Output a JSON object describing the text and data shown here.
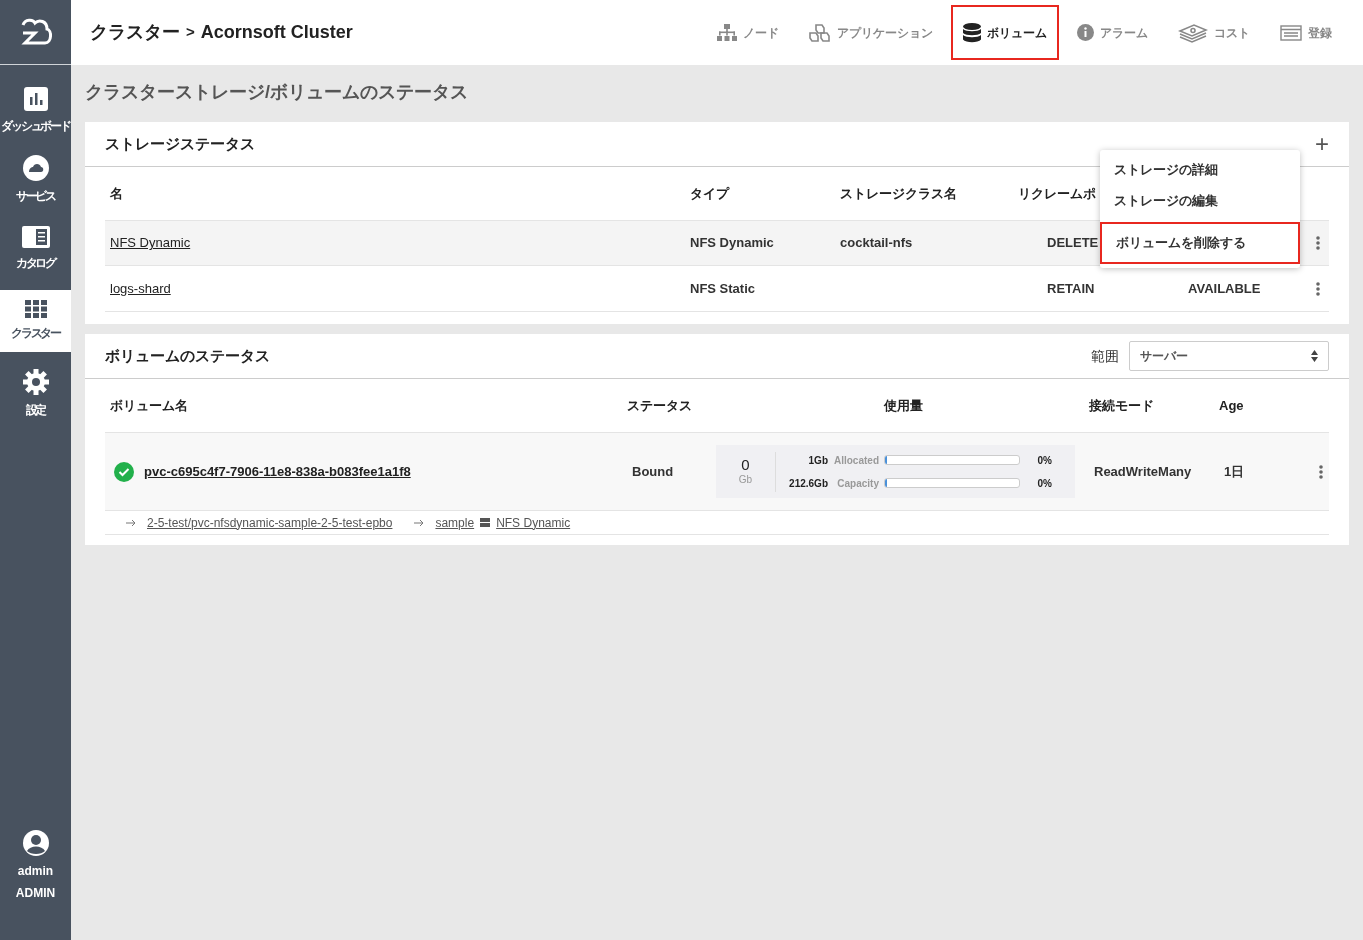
{
  "sidebar": {
    "items": [
      {
        "label": "ダッシュボード",
        "selected": false
      },
      {
        "label": "サービス",
        "selected": false
      },
      {
        "label": "カタログ",
        "selected": false
      },
      {
        "label": "クラスター",
        "selected": true
      },
      {
        "label": "設定",
        "selected": false
      }
    ],
    "user": {
      "name": "admin",
      "role": "ADMIN"
    }
  },
  "header": {
    "breadcrumb_root": "クラスター",
    "separator": ">",
    "cluster": "Acornsoft Cluster",
    "nav": [
      {
        "label": "ノード",
        "selected": false,
        "highlighted": false
      },
      {
        "label": "アプリケーション",
        "selected": false,
        "highlighted": false
      },
      {
        "label": "ボリューム",
        "selected": true,
        "highlighted": true
      },
      {
        "label": "アラーム",
        "selected": false,
        "highlighted": false
      },
      {
        "label": "コスト",
        "selected": false,
        "highlighted": false
      },
      {
        "label": "登録",
        "selected": false,
        "highlighted": false
      }
    ]
  },
  "page_title": "クラスターストレージ/ボリュームのステータス",
  "storage": {
    "title": "ストレージステータス",
    "add": "+",
    "columns": [
      "名",
      "タイプ",
      "ストレージクラス名",
      "リクレームポ"
    ],
    "rows": [
      {
        "name": "NFS Dynamic",
        "type": "NFS Dynamic",
        "class": "cocktail-nfs",
        "reclaim": "DELETE",
        "highlighted": true
      },
      {
        "name": "logs-shard",
        "type": "NFS Static",
        "reclaim": "RETAIN",
        "status": "AVAILABLE",
        "highlighted": false
      }
    ],
    "menu": [
      {
        "label": "ストレージの詳細",
        "highlighted": false
      },
      {
        "label": "ストレージの編集",
        "highlighted": false
      },
      {
        "label": "ボリュームを削除する",
        "highlighted": true
      }
    ]
  },
  "volumes": {
    "title": "ボリュームのステータス",
    "scope_label": "範囲",
    "scope_value": "サーバー",
    "columns": [
      "ボリューム名",
      "ステータス",
      "使用量",
      "接続モード",
      "Age"
    ],
    "rows": [
      {
        "name": "pvc-c695c4f7-7906-11e8-838a-b083fee1a1f8",
        "ok": true,
        "status": "Bound",
        "usage": {
          "used": "0",
          "unit": "Gb",
          "meters": [
            {
              "size": "1Gb",
              "label": "Allocated",
              "level": 0,
              "percent": "0%"
            },
            {
              "size": "212.6Gb",
              "label": "Capacity",
              "level": 0,
              "percent": "0%"
            }
          ]
        },
        "mode": "ReadWriteMany",
        "age": "1日",
        "links": [
          "2-5-test/pvc-nfsdynamic-sample-2-5-test-epbo",
          "sample",
          "NFS Dynamic"
        ]
      }
    ]
  }
}
